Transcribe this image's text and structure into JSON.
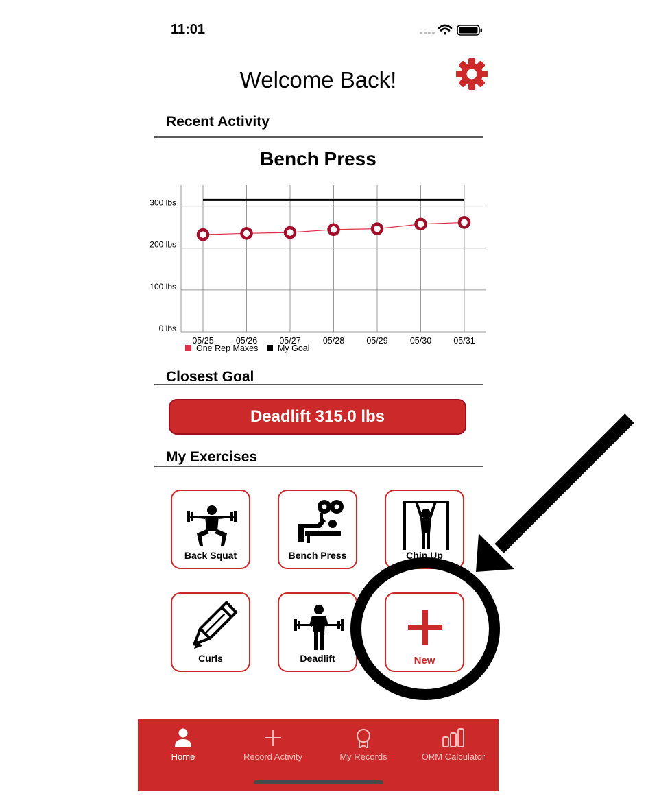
{
  "status_bar": {
    "time": "11:01"
  },
  "header": {
    "title": "Welcome Back!",
    "settings_icon": "gear-icon"
  },
  "sections": {
    "recent_activity": "Recent Activity",
    "closest_goal": "Closest Goal",
    "my_exercises": "My Exercises"
  },
  "chart_data": {
    "type": "line",
    "title": "Bench Press",
    "categories": [
      "05/25",
      "05/26",
      "05/27",
      "05/28",
      "05/29",
      "05/30",
      "05/31"
    ],
    "y_ticks": [
      "0 lbs",
      "100 lbs",
      "200 lbs",
      "300 lbs"
    ],
    "ylim": [
      0,
      350
    ],
    "grid": true,
    "series": [
      {
        "name": "One Rep Maxes",
        "values": [
          232,
          235,
          237,
          244,
          246,
          257,
          261
        ],
        "color": "#a0102a"
      },
      {
        "name": "My Goal",
        "values": [
          315,
          315,
          315,
          315,
          315,
          315,
          315
        ],
        "color": "#000000"
      }
    ],
    "legend_position": "bottom-left"
  },
  "closest_goal": {
    "label": "Deadlift 315.0 lbs"
  },
  "exercises": [
    {
      "label": "Back Squat",
      "icon": "squat-icon"
    },
    {
      "label": "Bench Press",
      "icon": "bench-press-icon"
    },
    {
      "label": "Chin Up",
      "icon": "chin-up-icon"
    },
    {
      "label": "Curls",
      "icon": "pencil-icon"
    },
    {
      "label": "Deadlift",
      "icon": "deadlift-icon"
    },
    {
      "label": "New",
      "icon": "plus-icon"
    }
  ],
  "tabbar": {
    "tabs": [
      {
        "label": "Home",
        "icon": "person-icon",
        "active": true
      },
      {
        "label": "Record Activity",
        "icon": "plus-icon"
      },
      {
        "label": "My Records",
        "icon": "ribbon-icon"
      },
      {
        "label": "ORM Calculator",
        "icon": "bar-chart-icon"
      }
    ]
  },
  "colors": {
    "accent": "#cc2a2a",
    "dark_red": "#a0102a",
    "line": "#e0304a"
  }
}
